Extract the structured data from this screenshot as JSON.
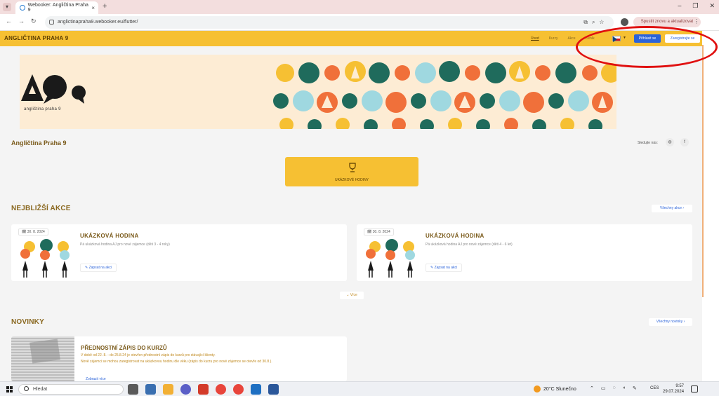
{
  "browser": {
    "tab_title": "Webooker: Angličtina Praha 9",
    "tab_close": "×",
    "new_tab": "+",
    "url": "anglictinapraha9.webooker.eu/flutter/",
    "update_button": "Spustit znovu a aktualizovat",
    "window_controls": {
      "minimize": "–",
      "restore": "❐",
      "close": "✕"
    },
    "nav": {
      "back": "←",
      "forward": "→",
      "reload": "↻"
    }
  },
  "site_header": {
    "brand": "ANGLIČTINA PRAHA 9",
    "nav_links": [
      "Úvod",
      "Kurzy",
      "Akce",
      "Ceník"
    ],
    "login_label": "Přihlásit se",
    "register_label": "Zaregistrujte se"
  },
  "banner": {
    "logo_subtitle": "angličtina praha 9"
  },
  "site_name": "Angličtina Praha 9",
  "follow_label": "Sledujte nás:",
  "hero_button": "UKÁZKOVÉ HODINY",
  "events": {
    "title": "NEJBLIŽŠÍ AKCE",
    "all_label": "Všechny akce",
    "more_label": "Více",
    "cards": [
      {
        "date": "30. 8. 2024",
        "title": "UKÁZKOVÁ HODINA",
        "desc": "Pá ukázková hodina AJ pro nové zájemce (děti 3 - 4 roky)",
        "action": "Zapsat na akci"
      },
      {
        "date": "30. 8. 2024",
        "title": "UKÁZKOVÁ HODINA",
        "desc": "Pá ukázková hodina AJ pro nové zájemce (děti 4 - 6 let)",
        "action": "Zapsat na akci"
      }
    ]
  },
  "news": {
    "title": "NOVINKY",
    "all_label": "Všechny novinky",
    "item": {
      "title": "PŘEDNOSTNÍ ZÁPIS DO KURZŮ",
      "line1": "V době od 22. 8. - do 25.8.24 je otevřen přednostní zápis do kurzů pro stávající klienty.",
      "line2": "Nově zájemci se mohou zaregistrovat na ukázkovou hodinu dle věku (zápis do kurzu pro nové zájemce se otevře od 30.8.).",
      "link": "Zobrazit více"
    }
  },
  "taskbar": {
    "search": "Hledat",
    "weather": "20°C Slunečno",
    "lang": "CES",
    "time": "9:57",
    "date": "29.07.2024"
  },
  "colors": {
    "brand_yellow": "#f6c033",
    "brand_brown": "#7a5a1a",
    "action_blue": "#2b63d9",
    "annotation_red": "#e01010"
  }
}
